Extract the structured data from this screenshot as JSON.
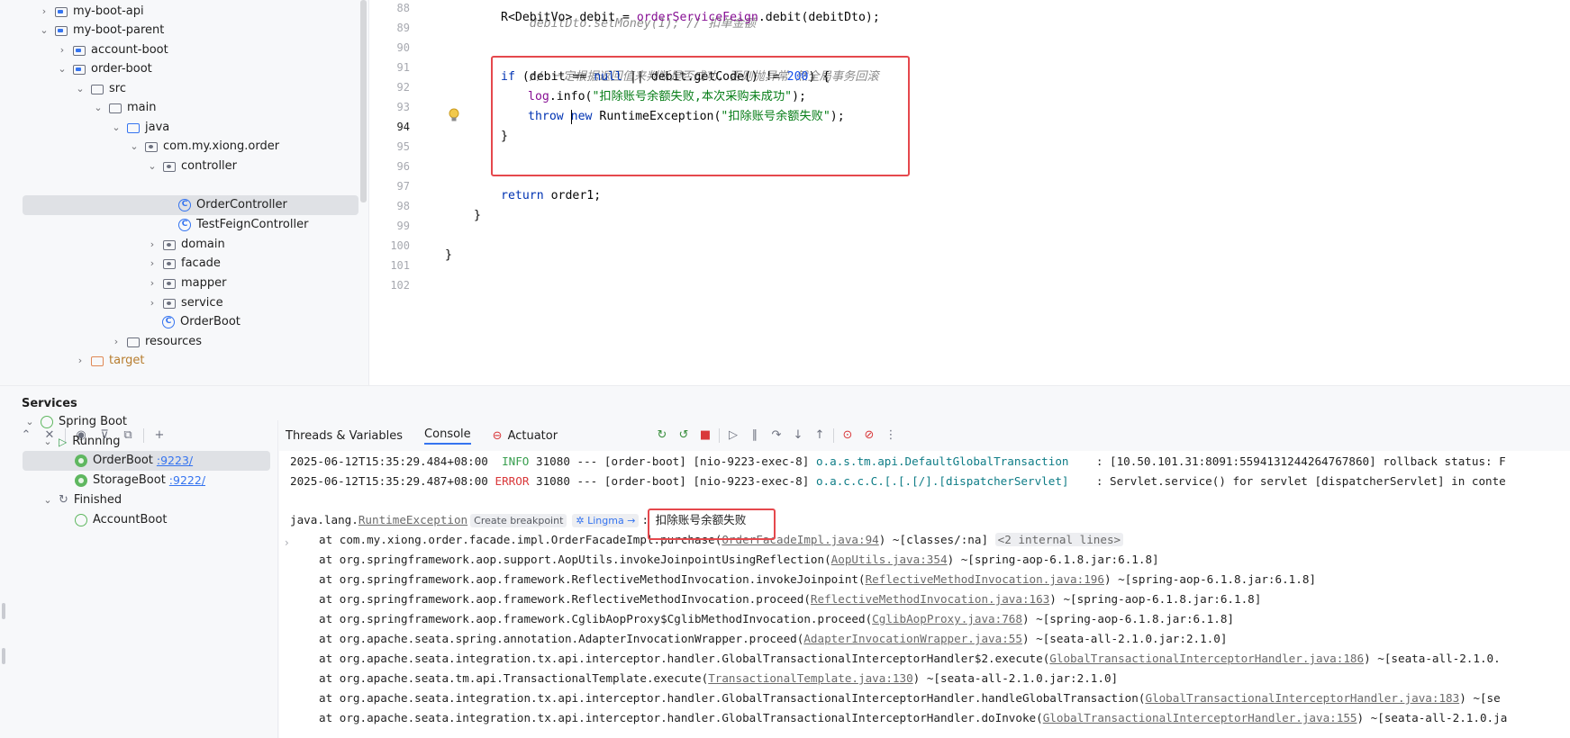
{
  "project_tree": {
    "items": [
      {
        "label": "my-boot-api",
        "kind": "module",
        "expanded": false
      },
      {
        "label": "my-boot-parent",
        "kind": "module",
        "expanded": true
      },
      {
        "label": "account-boot",
        "kind": "module",
        "expanded": false
      },
      {
        "label": "order-boot",
        "kind": "module",
        "expanded": true
      },
      {
        "label": "src",
        "kind": "folder",
        "expanded": true
      },
      {
        "label": "main",
        "kind": "folder",
        "expanded": true
      },
      {
        "label": "java",
        "kind": "source-folder",
        "expanded": true
      },
      {
        "label": "com.my.xiong.order",
        "kind": "package",
        "expanded": true
      },
      {
        "label": "controller",
        "kind": "package",
        "expanded": true
      },
      {
        "label": "OrderController",
        "kind": "class",
        "selected": true
      },
      {
        "label": "TestFeignController",
        "kind": "class"
      },
      {
        "label": "domain",
        "kind": "package",
        "expanded": false
      },
      {
        "label": "facade",
        "kind": "package",
        "expanded": false
      },
      {
        "label": "mapper",
        "kind": "package",
        "expanded": false
      },
      {
        "label": "service",
        "kind": "package",
        "expanded": false
      },
      {
        "label": "OrderBoot",
        "kind": "boot-class"
      },
      {
        "label": "resources",
        "kind": "folder",
        "expanded": false
      },
      {
        "label": "target",
        "kind": "target-folder",
        "expanded": false
      }
    ]
  },
  "editor": {
    "line_numbers": [
      "88",
      "89",
      "90",
      "91",
      "92",
      "93",
      "94",
      "95",
      "96",
      "97",
      "98",
      "99",
      "100",
      "101",
      "102"
    ],
    "current_line": "94",
    "code": {
      "l88": "debitDto.setMoney(1); // 扣单金额",
      "l89_type": "R<DebitVo> debit = ",
      "l89_field": "orderServiceFeign",
      "l89_rest": ".debit(debitDto);",
      "l91": "// 一定根据返回值来判断是否成功，否则抛异常 然全局事务回滚",
      "l92_if": "if",
      "l92_a": " (debit == ",
      "l92_null": "null",
      "l92_b": " || debit.getCode() != ",
      "l92_num": "200",
      "l92_c": ") {",
      "l93_log": "log",
      "l93_a": ".info(",
      "l93_str": "\"扣除账号余额失败,本次采购未成功\"",
      "l93_b": ");",
      "l94_throw": "throw",
      "l94_new": "new",
      "l94_a": " RuntimeException(",
      "l94_str": "\"扣除账号余额失败\"",
      "l94_b": ");",
      "l95": "}",
      "l98_return": "return",
      "l98_a": " order1;",
      "l99": "}",
      "l101": "}"
    }
  },
  "services": {
    "title": "Services",
    "tree": {
      "root": "Spring Boot",
      "running_group": "Running",
      "running": [
        {
          "name": "OrderBoot",
          "port": ":9223/",
          "selected": true
        },
        {
          "name": "StorageBoot",
          "port": ":9222/"
        }
      ],
      "finished_group": "Finished",
      "finished": [
        {
          "name": "AccountBoot"
        }
      ]
    },
    "tabs": [
      "Threads & Variables",
      "Console",
      "Actuator"
    ],
    "active_tab": "Console"
  },
  "console": {
    "log1": {
      "timestamp": "2025-06-12T15:35:29.484+08:00",
      "level": "INFO",
      "pid": "31080",
      "sep": "---",
      "app": "[order-boot]",
      "thread": "[nio-9223-exec-8]",
      "logger": "o.a.s.tm.api.DefaultGlobalTransaction",
      "message": ": [10.50.101.31:8091:5594131244264767860] rollback status: F"
    },
    "log2": {
      "timestamp": "2025-06-12T15:35:29.487+08:00",
      "level": "ERROR",
      "pid": "31080",
      "sep": "---",
      "app": "[order-boot]",
      "thread": "[nio-9223-exec-8]",
      "logger": "o.a.c.c.C.[.[.[/].[dispatcherServlet]",
      "message": ": Servlet.service() for servlet [dispatcherServlet] in conte"
    },
    "exception": {
      "class_prefix": "java.lang.",
      "class_name": "RuntimeException",
      "breakpoint_hint": "Create breakpoint",
      "lingma_hint": "Lingma →",
      "message": ": 扣除账号余额失败"
    },
    "stack": [
      {
        "at": "at com.my.xiong.order.facade.impl.OrderFacadeImpl.purchase(",
        "link": "OrderFacadeImpl.java:94",
        "tail": ") ~[classes/:na]",
        "pill": "<2 internal lines>"
      },
      {
        "at": "at org.springframework.aop.support.AopUtils.invokeJoinpointUsingReflection(",
        "link": "AopUtils.java:354",
        "tail": ") ~[spring-aop-6.1.8.jar:6.1.8]"
      },
      {
        "at": "at org.springframework.aop.framework.ReflectiveMethodInvocation.invokeJoinpoint(",
        "link": "ReflectiveMethodInvocation.java:196",
        "tail": ") ~[spring-aop-6.1.8.jar:6.1.8]"
      },
      {
        "at": "at org.springframework.aop.framework.ReflectiveMethodInvocation.proceed(",
        "link": "ReflectiveMethodInvocation.java:163",
        "tail": ") ~[spring-aop-6.1.8.jar:6.1.8]"
      },
      {
        "at": "at org.springframework.aop.framework.CglibAopProxy$CglibMethodInvocation.proceed(",
        "link": "CglibAopProxy.java:768",
        "tail": ") ~[spring-aop-6.1.8.jar:6.1.8]"
      },
      {
        "at": "at org.apache.seata.spring.annotation.AdapterInvocationWrapper.proceed(",
        "link": "AdapterInvocationWrapper.java:55",
        "tail": ") ~[seata-all-2.1.0.jar:2.1.0]"
      },
      {
        "at": "at org.apache.seata.integration.tx.api.interceptor.handler.GlobalTransactionalInterceptorHandler$2.execute(",
        "link": "GlobalTransactionalInterceptorHandler.java:186",
        "tail": ") ~[seata-all-2.1.0."
      },
      {
        "at": "at org.apache.seata.tm.api.TransactionalTemplate.execute(",
        "link": "TransactionalTemplate.java:130",
        "tail": ") ~[seata-all-2.1.0.jar:2.1.0]"
      },
      {
        "at": "at org.apache.seata.integration.tx.api.interceptor.handler.GlobalTransactionalInterceptorHandler.handleGlobalTransaction(",
        "link": "GlobalTransactionalInterceptorHandler.java:183",
        "tail": ") ~[se"
      },
      {
        "at": "at org.apache.seata.integration.tx.api.interceptor.handler.GlobalTransactionalInterceptorHandler.doInvoke(",
        "link": "GlobalTransactionalInterceptorHandler.java:155",
        "tail": ") ~[seata-all-2.1.0.ja"
      }
    ]
  },
  "colors": {
    "highlight_box": "#e5484d",
    "accent": "#3574f0",
    "error": "#d9383a",
    "info": "#389e4e"
  }
}
